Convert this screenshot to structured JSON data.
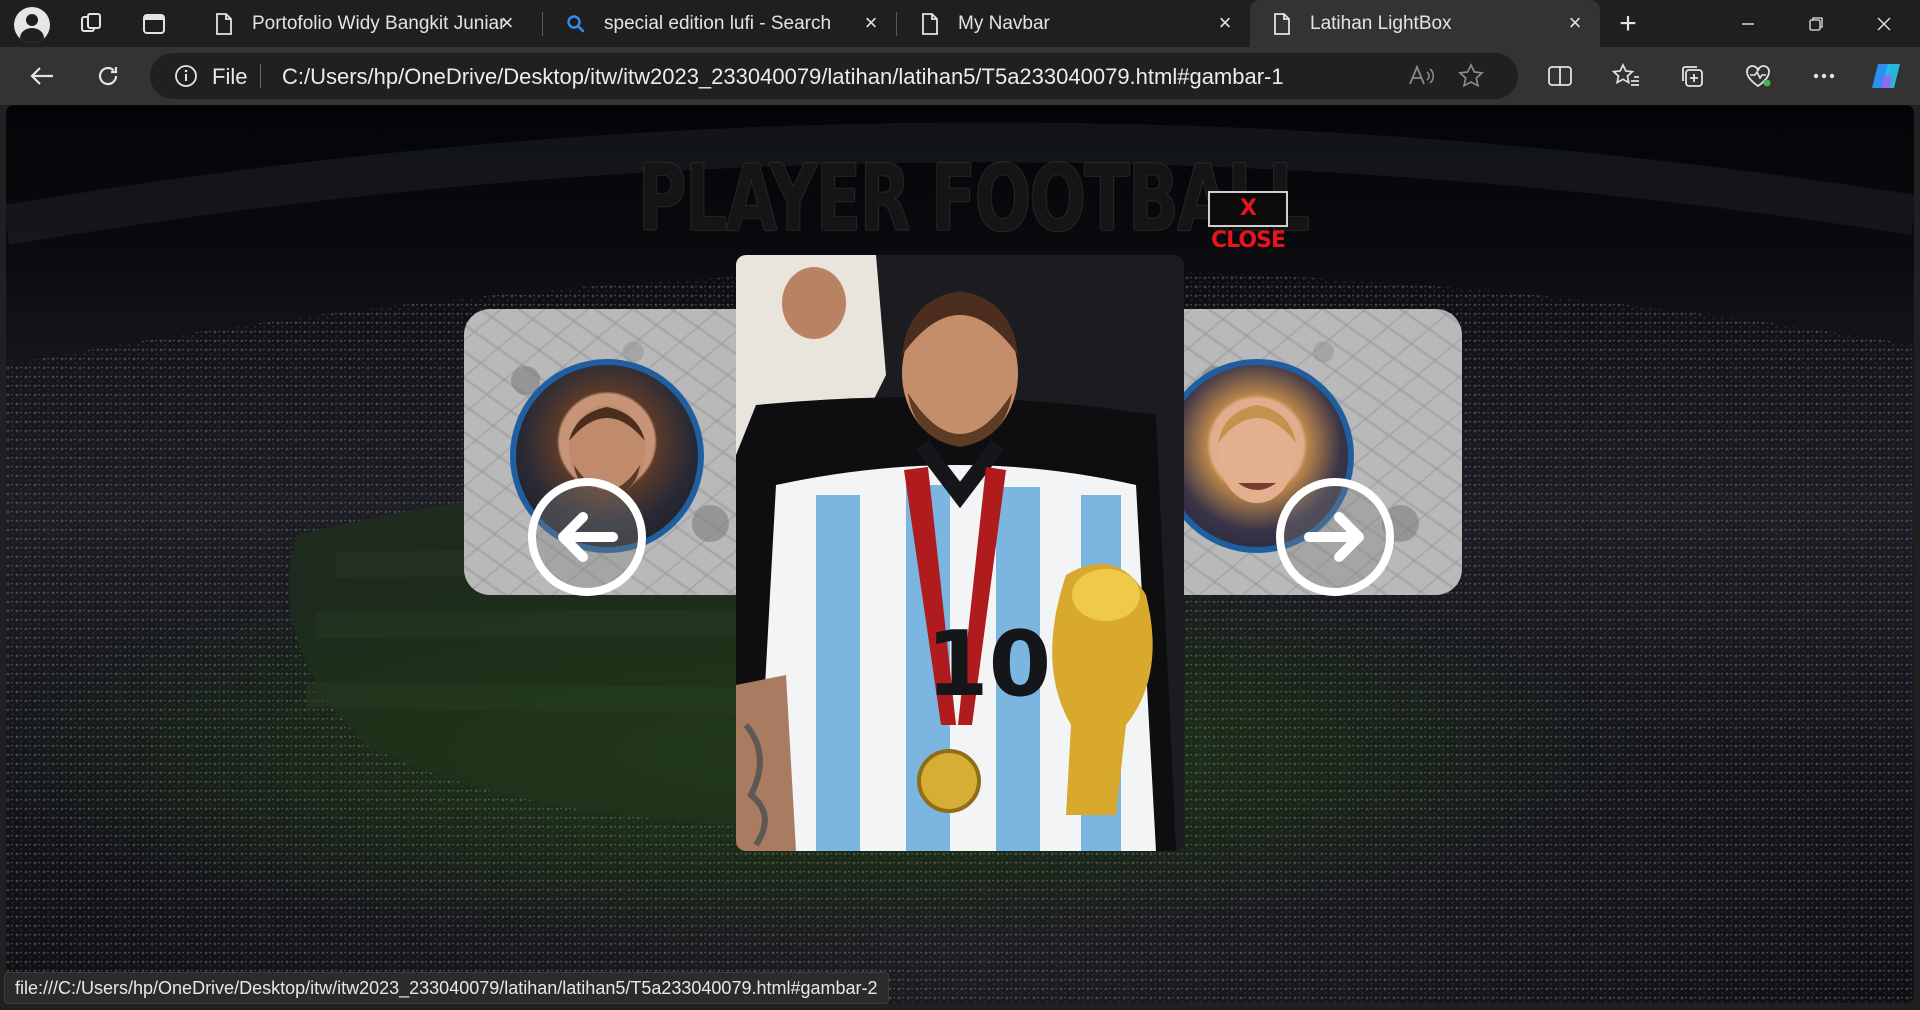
{
  "tabs": [
    {
      "label": "Portofolio Widy Bangkit Juniar",
      "favicon": "page-icon",
      "active": false
    },
    {
      "label": "special edition lufi - Search",
      "favicon": "search-icon",
      "active": false
    },
    {
      "label": "My Navbar",
      "favicon": "page-icon",
      "active": false
    },
    {
      "label": "Latihan LightBox",
      "favicon": "page-icon",
      "active": true
    }
  ],
  "toolbar": {
    "scheme_label": "File",
    "url": "C:/Users/hp/OneDrive/Desktop/itw/itw2023_233040079/latihan/latihan5/T5a233040079.html#gambar-1"
  },
  "page": {
    "title": "PLAYER FOOTBALL",
    "close_label": "X CLOSE"
  },
  "status_bar": {
    "text": "file:///C:/Users/hp/OneDrive/Desktop/itw/itw2023_233040079/latihan/latihan5/T5a233040079.html#gambar-2"
  },
  "colors": {
    "accent_blue": "#1f5fa0",
    "close_red": "#e8141b",
    "active_tab": "#333333"
  }
}
